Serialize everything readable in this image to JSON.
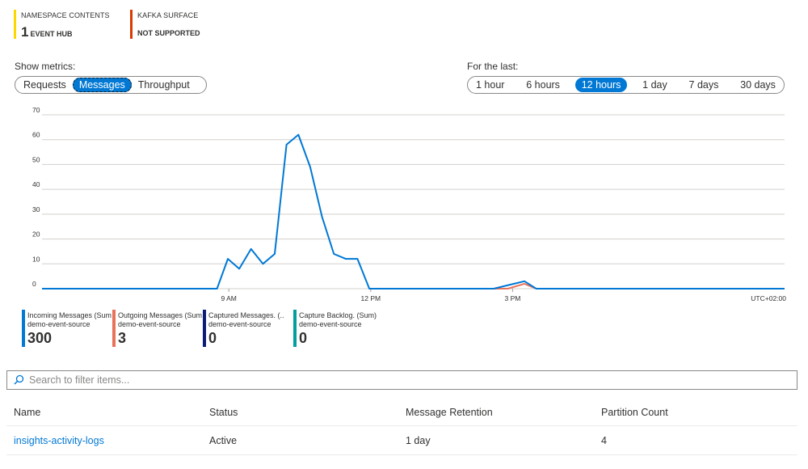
{
  "summary": [
    {
      "title": "NAMESPACE CONTENTS",
      "value": "1",
      "value_suffix": "EVENT HUB",
      "color": "#ffd700"
    },
    {
      "title": "KAFKA SURFACE",
      "value": "",
      "value_suffix": "NOT SUPPORTED",
      "color": "#d83b01"
    }
  ],
  "metrics": {
    "label": "Show metrics:",
    "options": [
      "Requests",
      "Messages",
      "Throughput"
    ],
    "selected": "Messages"
  },
  "timerange": {
    "label": "For the last:",
    "options": [
      "1 hour",
      "6 hours",
      "12 hours",
      "1 day",
      "7 days",
      "30 days"
    ],
    "selected": "12 hours"
  },
  "chart_data": {
    "type": "line",
    "ylim": [
      0,
      70
    ],
    "yticks": [
      0,
      10,
      20,
      30,
      40,
      50,
      60,
      70
    ],
    "xlim": [
      5.05,
      20.75
    ],
    "xticks": [
      {
        "x": 9,
        "label": "9 AM"
      },
      {
        "x": 12,
        "label": "12 PM"
      },
      {
        "x": 15,
        "label": "3 PM"
      }
    ],
    "timezone_label": "UTC+02:00",
    "grid": true,
    "series": [
      {
        "name": "Incoming Messages (Sum)",
        "color": "#0078d4",
        "x": [
          5.05,
          8.75,
          8.98,
          9.22,
          9.47,
          9.72,
          9.97,
          10.22,
          10.47,
          10.72,
          10.97,
          11.22,
          11.47,
          11.72,
          11.97,
          12.22,
          14.6,
          15.25,
          15.5,
          20.75
        ],
        "y": [
          0,
          0,
          12,
          8,
          16,
          10,
          14,
          58,
          62,
          49,
          29,
          14,
          12,
          12,
          0,
          0,
          0,
          3,
          0,
          0
        ]
      },
      {
        "name": "Outgoing Messages (Sum)",
        "color": "#e8735a",
        "x": [
          14.6,
          14.9,
          15.25,
          15.5
        ],
        "y": [
          0,
          0,
          2,
          0
        ]
      }
    ]
  },
  "legend": [
    {
      "name": "Incoming Messages (Sum",
      "source": "demo-event-source",
      "value": "300",
      "color": "#0078d4"
    },
    {
      "name": "Outgoing Messages (Sum",
      "source": "demo-event-source",
      "value": "3",
      "color": "#e8735a"
    },
    {
      "name": "Captured Messages. (..",
      "source": "demo-event-source",
      "value": "0",
      "color": "#0b1d78"
    },
    {
      "name": "Capture Backlog. (Sum)",
      "source": "demo-event-source",
      "value": "0",
      "color": "#009e9e"
    }
  ],
  "search": {
    "placeholder": "Search to filter items..."
  },
  "table": {
    "columns": [
      "Name",
      "Status",
      "Message Retention",
      "Partition Count"
    ],
    "rows": [
      {
        "name": "insights-activity-logs",
        "status": "Active",
        "retention": "1 day",
        "partitions": "4"
      }
    ]
  }
}
